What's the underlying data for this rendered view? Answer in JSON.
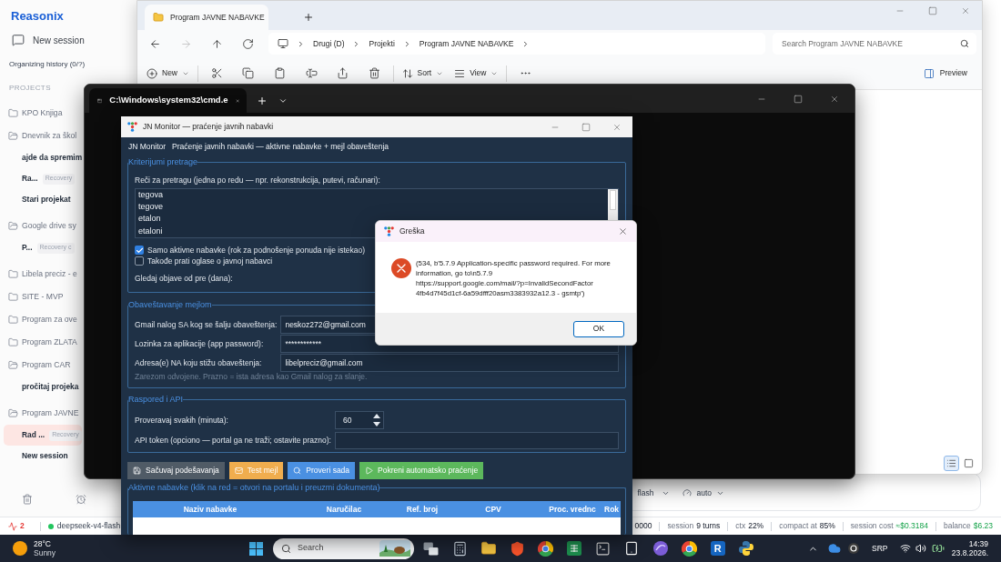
{
  "reasonix": {
    "logo": "Reasonix",
    "new_session": "New session",
    "history_status": "Organizing history (0/?)",
    "projects_heading": "PROJECTS",
    "projects": [
      {
        "name": "KPO Knjiga",
        "expanded": false
      },
      {
        "name": "Dnevnik za škol",
        "expanded": true,
        "children": [
          {
            "title": "ajde da spremim",
            "selected": false
          },
          {
            "title": "Ra...",
            "badge": "Recovery",
            "selected": false
          },
          {
            "title": "Stari projekat",
            "selected": false
          }
        ]
      },
      {
        "name": "Google drive sy",
        "expanded": true,
        "children": [
          {
            "title": "P...",
            "badge": "Recovery c",
            "selected": false
          }
        ]
      },
      {
        "name": "Libela preciz - e",
        "expanded": false
      },
      {
        "name": "SITE - MVP",
        "expanded": false
      },
      {
        "name": "Program za ove",
        "expanded": false
      },
      {
        "name": "Program ZLATA",
        "expanded": false
      },
      {
        "name": "Program CAR",
        "expanded": true,
        "children": [
          {
            "title": "pročitaj projeka",
            "selected": false
          }
        ]
      },
      {
        "name": "Program JAVNE",
        "expanded": true,
        "children": [
          {
            "title": "Rad ...",
            "badge": "Recovery",
            "selected": true
          },
          {
            "title": "New session",
            "selected": false
          }
        ]
      }
    ],
    "composer": {
      "model": "flash",
      "mode": "auto"
    },
    "status_bar": {
      "alerts": "2",
      "model": "deepseek-v4-flash",
      "items": [
        {
          "value": "0000",
          "kind": "plain"
        },
        {
          "label": "session",
          "value": "9 turns",
          "kind": "plain"
        },
        {
          "label": "ctx",
          "value": "22%",
          "kind": "plain"
        },
        {
          "label": "compact at",
          "value": "85%",
          "kind": "plain"
        },
        {
          "label": "session cost",
          "value": "≈$0.3184",
          "kind": "money"
        },
        {
          "label": "balance",
          "value": "$6.23",
          "kind": "money"
        }
      ]
    }
  },
  "explorer": {
    "tabs": [
      {
        "title": "Program JAVNE NABAVKE",
        "selected": true
      }
    ],
    "nav": [
      {
        "kind": "back",
        "disabled": false
      },
      {
        "kind": "forward",
        "disabled": true
      },
      {
        "kind": "up",
        "disabled": false
      },
      {
        "kind": "refresh",
        "disabled": false
      }
    ],
    "path": [
      "Drugi (D)",
      "Projekti",
      "Program JAVNE NABAVKE"
    ],
    "search_placeholder": "Search Program JAVNE NABAVKE",
    "toolbar_groups": [
      {
        "items": [
          {
            "kind": "new",
            "label": "New"
          }
        ]
      },
      {
        "items": [
          {
            "kind": "cut"
          },
          {
            "kind": "copy"
          },
          {
            "kind": "paste"
          },
          {
            "kind": "rename"
          },
          {
            "kind": "share"
          },
          {
            "kind": "delete"
          }
        ]
      },
      {
        "items": [
          {
            "kind": "sort",
            "label": "Sort"
          },
          {
            "kind": "view",
            "label": "View"
          }
        ]
      },
      {
        "items": [
          {
            "kind": "more"
          }
        ]
      }
    ],
    "preview": "Preview",
    "view_modes": [
      {
        "kind": "details",
        "selected": true
      },
      {
        "kind": "tiles",
        "selected": false
      }
    ]
  },
  "terminal": {
    "tab": "C:\\Windows\\system32\\cmd.e"
  },
  "jn_monitor": {
    "title": "JN Monitor — praćenje javnih nabavki",
    "app_name": "JN Monitor",
    "subtitle": "Praćenje javnih nabavki — aktivne nabavke + mejl obaveštenja",
    "search": {
      "legend": "Kriterijumi pretrage",
      "keywords_label": "Reči za pretragu (jedna po redu — npr. rekonstrukcija, putevi, računari):",
      "keywords": [
        "tegova",
        "tegove",
        "etalon",
        "etaloni"
      ],
      "options": [
        {
          "label": "Samo aktivne nabavke (rok za podnošenje ponuda nije istekao)",
          "checked": true
        },
        {
          "label": "Takođe prati oglase o javnoj nabavci",
          "checked": false
        }
      ],
      "days_label": "Gledaj objave od pre (dana):"
    },
    "email": {
      "legend": "Obaveštavanje mejlom",
      "fields": [
        {
          "label": "Gmail nalog SA kog se šalju obaveštenja:",
          "value": "neskoz272@gmail.com"
        },
        {
          "label": "Lozinka za aplikacije (app password):",
          "value": "************"
        },
        {
          "label": "Adresa(e) NA koju stižu obaveštenja:",
          "value": "libelpreciz@gmail.com"
        }
      ],
      "hint": "Zarezom odvojene. Prazno = ista adresa kao Gmail nalog za slanje."
    },
    "schedule": {
      "legend": "Raspored i API",
      "interval_label": "Proveravaj svakih (minuta):",
      "interval": "60",
      "token_label": "API token (opciono — portal ga ne traži; ostavite prazno):"
    },
    "buttons": [
      {
        "kind": "save",
        "label": "Sačuvaj podešavanja"
      },
      {
        "kind": "mail",
        "label": "Test mejl"
      },
      {
        "kind": "check",
        "label": "Proveri sada"
      },
      {
        "kind": "start",
        "label": "Pokreni automatsko praćenje"
      }
    ],
    "results": {
      "legend": "Aktivne nabavke (klik na red = otvori na portalu i preuzmi dokumenta)",
      "columns": [
        "Naziv nabavke",
        "Naručilac",
        "Ref. broj",
        "CPV",
        "Proc. vrednc",
        "Rok"
      ]
    }
  },
  "error_dialog": {
    "title": "Greška",
    "message": "(534, b'5.7.9 Application-specific password required. For more information, go to\\n5.7.9 https://support.google.com/mail/?p=InvalidSecondFactor 4fb4d7f45d1cf-6a59dfff20asm3383932a12.3 - gsmtp')",
    "ok": "OK"
  },
  "taskbar": {
    "weather": {
      "temp": "28°C",
      "condition": "Sunny"
    },
    "search_placeholder": "Search",
    "apps": [
      {
        "kind": "taskview"
      },
      {
        "kind": "calculator"
      },
      {
        "kind": "files"
      },
      {
        "kind": "shield"
      },
      {
        "kind": "browser"
      },
      {
        "kind": "sheet"
      },
      {
        "kind": "terminal"
      },
      {
        "kind": "tablet"
      },
      {
        "kind": "orb"
      },
      {
        "kind": "browser"
      },
      {
        "kind": "letter",
        "label": "R"
      },
      {
        "kind": "snake"
      }
    ],
    "language": "SRP",
    "time": "14:39",
    "date": "23.8.2026."
  }
}
